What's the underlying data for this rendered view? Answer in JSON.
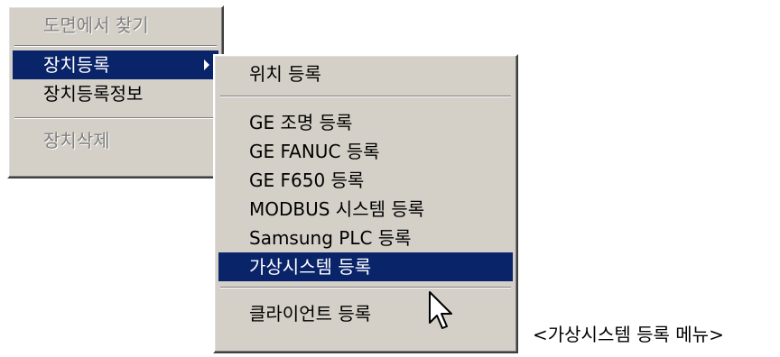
{
  "main_menu": {
    "items": [
      {
        "label": "도면에서 찾기",
        "state": "disabled"
      },
      {
        "label": "장치등록",
        "state": "selected",
        "has_submenu": true
      },
      {
        "label": "장치등록정보",
        "state": "normal"
      },
      {
        "label": "장치삭제",
        "state": "disabled"
      }
    ]
  },
  "submenu": {
    "items": [
      {
        "label": "위치 등록"
      },
      {
        "label": "GE 조명 등록"
      },
      {
        "label": "GE FANUC 등록"
      },
      {
        "label": "GE F650 등록"
      },
      {
        "label": "MODBUS 시스템 등록"
      },
      {
        "label": "Samsung PLC 등록"
      },
      {
        "label": "가상시스템 등록",
        "state": "selected"
      },
      {
        "label": "클라이언트 등록"
      }
    ]
  },
  "caption": "<가상시스템 등록 메뉴>",
  "colors": {
    "menu_bg": "#d4d0c8",
    "highlight_bg": "#0a246a",
    "highlight_text": "#ffffff",
    "disabled_text": "#808080"
  },
  "cursor_icon": "arrow-pointer-icon"
}
